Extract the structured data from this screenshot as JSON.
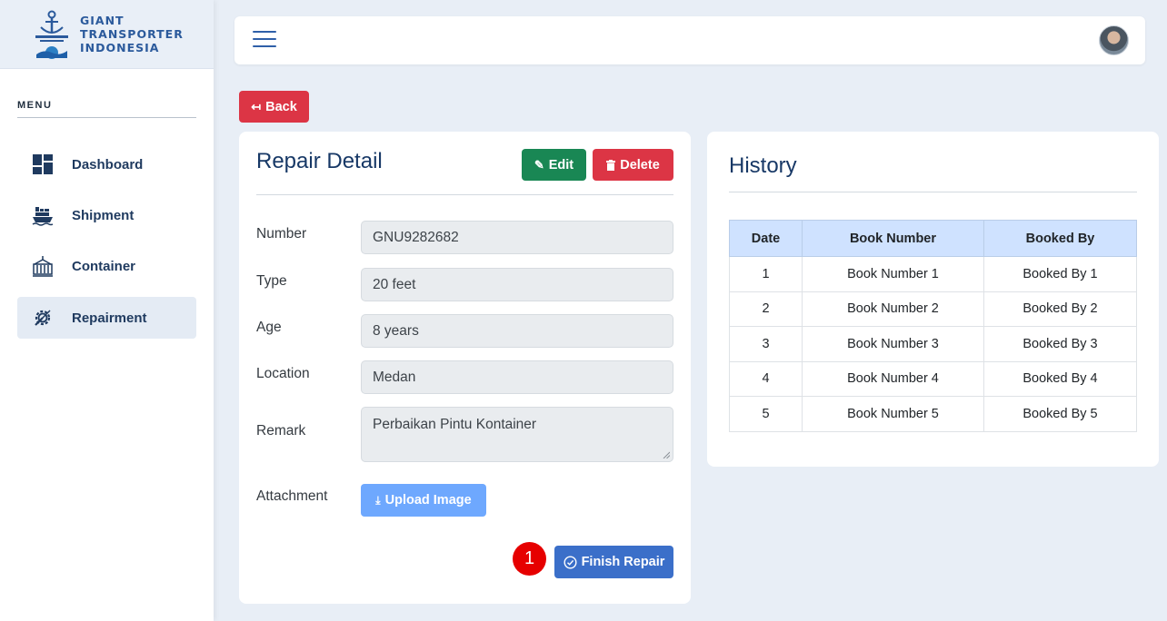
{
  "brand": {
    "line1": "GIANT",
    "line2": "TRANSPORTER",
    "line3": "INDONESIA"
  },
  "sidebar": {
    "menu_title": "MENU",
    "items": [
      {
        "label": "Dashboard",
        "icon": "dashboard-icon"
      },
      {
        "label": "Shipment",
        "icon": "ship-icon"
      },
      {
        "label": "Container",
        "icon": "container-icon"
      },
      {
        "label": "Repairment",
        "icon": "gear-icon",
        "active": true
      }
    ]
  },
  "actions": {
    "back": "Back",
    "edit": "Edit",
    "delete": "Delete",
    "upload": "Upload Image",
    "finish": "Finish Repair"
  },
  "repair": {
    "title": "Repair Detail",
    "fields": [
      {
        "label": "Number",
        "value": "GNU9282682"
      },
      {
        "label": "Type",
        "value": "20 feet"
      },
      {
        "label": "Age",
        "value": "8 years"
      },
      {
        "label": "Location",
        "value": "Medan"
      },
      {
        "label": "Remark",
        "value": "Perbaikan Pintu Kontainer"
      },
      {
        "label": "Attachment",
        "value": ""
      }
    ]
  },
  "history": {
    "title": "History",
    "columns": [
      "Date",
      "Book Number",
      "Booked By"
    ],
    "rows": [
      [
        "1",
        "Book Number 1",
        "Booked By 1"
      ],
      [
        "2",
        "Book Number 2",
        "Booked By 2"
      ],
      [
        "3",
        "Book Number 3",
        "Booked By 3"
      ],
      [
        "4",
        "Book Number 4",
        "Booked By 4"
      ],
      [
        "5",
        "Book Number 5",
        "Booked By 5"
      ]
    ]
  },
  "annotation": {
    "step": "1"
  },
  "colors": {
    "primary": "#3b6fc9",
    "danger": "#dc3545",
    "success": "#198754",
    "upload": "#6ea8fe",
    "table_header": "#cfe2ff",
    "title": "#173866"
  }
}
